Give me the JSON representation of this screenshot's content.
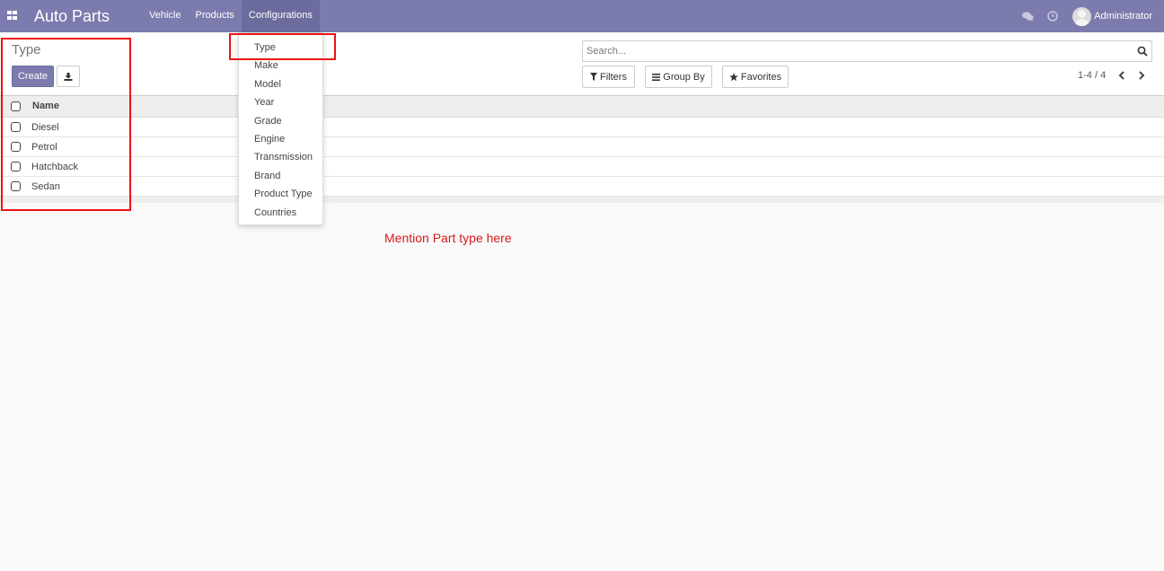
{
  "navbar": {
    "brand": "Auto Parts",
    "menu": [
      {
        "label": "Vehicle"
      },
      {
        "label": "Products"
      },
      {
        "label": "Configurations"
      }
    ],
    "user_name": "Administrator"
  },
  "control_panel": {
    "title": "Type",
    "create_label": "Create",
    "search_placeholder": "Search...",
    "filters_label": "Filters",
    "group_by_label": "Group By",
    "favorites_label": "Favorites",
    "pager": "1-4 / 4"
  },
  "list": {
    "column_name": "Name",
    "rows": [
      "Diesel",
      "Petrol",
      "Hatchback",
      "Sedan"
    ]
  },
  "dropdown": {
    "items": [
      "Type",
      "Make",
      "Model",
      "Year",
      "Grade",
      "Engine",
      "Transmission",
      "Brand",
      "Product Type",
      "Countries"
    ]
  },
  "annotation": "Mention Part type here",
  "colors": {
    "navbar": "#7c7bad",
    "primary": "#7c7bad",
    "highlight": "#e11111"
  }
}
